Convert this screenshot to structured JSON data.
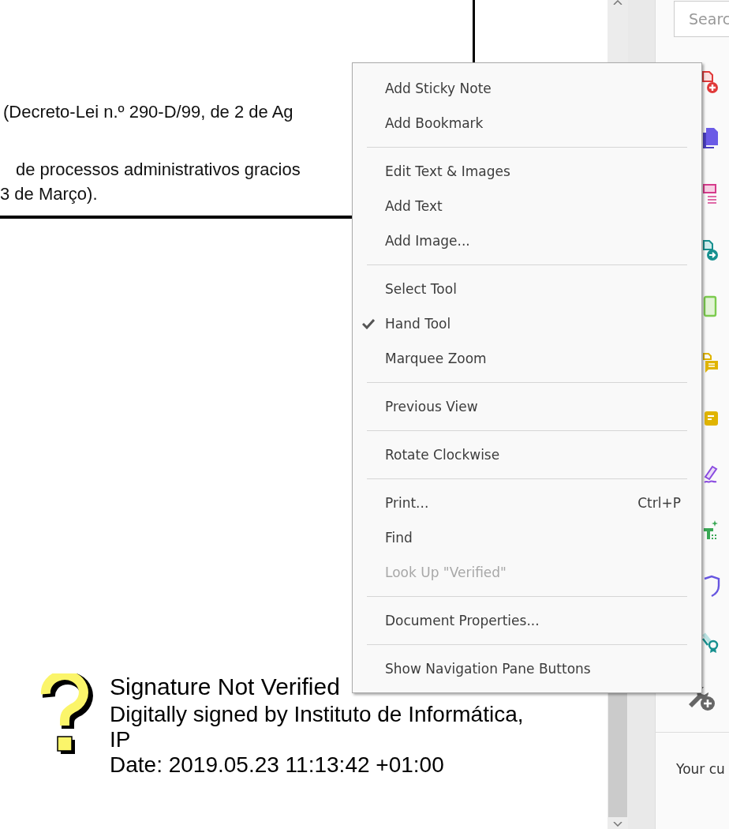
{
  "document": {
    "lines": [
      "(Decreto-Lei n.º 290-D/99, de 2 de Ag",
      "de processos administrativos gracios",
      "3 de Março)."
    ],
    "signature": {
      "status": "Signature Not Verified",
      "signed_by": "Digitally signed by Instituto de Informática, IP",
      "date": "Date: 2019.05.23 11:13:42 +01:00"
    }
  },
  "context_menu": {
    "groups": [
      [
        {
          "label": "Add Sticky Note",
          "checked": false,
          "disabled": false
        },
        {
          "label": "Add Bookmark",
          "checked": false,
          "disabled": false
        }
      ],
      [
        {
          "label": "Edit Text & Images",
          "checked": false,
          "disabled": false
        },
        {
          "label": "Add Text",
          "checked": false,
          "disabled": false
        },
        {
          "label": "Add Image...",
          "checked": false,
          "disabled": false
        }
      ],
      [
        {
          "label": "Select Tool",
          "checked": false,
          "disabled": false
        },
        {
          "label": "Hand Tool",
          "checked": true,
          "disabled": false
        },
        {
          "label": "Marquee Zoom",
          "checked": false,
          "disabled": false
        }
      ],
      [
        {
          "label": "Previous View",
          "checked": false,
          "disabled": false
        }
      ],
      [
        {
          "label": "Rotate Clockwise",
          "checked": false,
          "disabled": false
        }
      ],
      [
        {
          "label": "Print...",
          "checked": false,
          "disabled": false,
          "shortcut": "Ctrl+P"
        },
        {
          "label": "Find",
          "checked": false,
          "disabled": false
        },
        {
          "label": "Look Up \"Verified\"",
          "checked": false,
          "disabled": true
        }
      ],
      [
        {
          "label": "Document Properties...",
          "checked": false,
          "disabled": false
        }
      ],
      [
        {
          "label": "Show Navigation Pane Buttons",
          "checked": false,
          "disabled": false
        }
      ]
    ]
  },
  "tools_panel": {
    "search": {
      "placeholder": "Searc"
    },
    "footer": "Your cu"
  }
}
